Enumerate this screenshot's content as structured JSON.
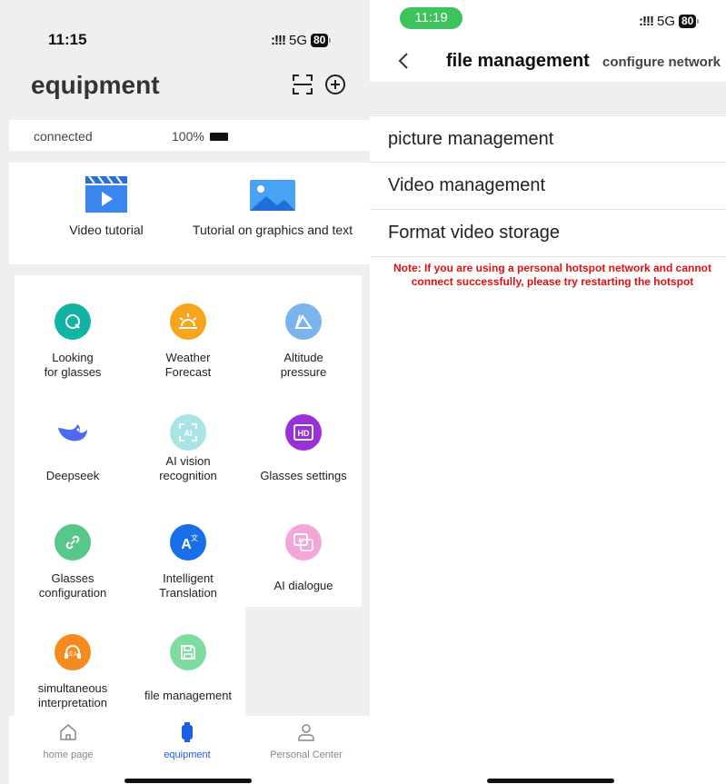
{
  "left": {
    "status": {
      "time": "11:15",
      "network": "5G",
      "battery": "80"
    },
    "header": {
      "title": "equipment"
    },
    "connection": {
      "status": "connected",
      "battery_pct": "100%"
    },
    "tutorials": [
      "Video tutorial",
      "Tutorial on graphics and text"
    ],
    "grid": [
      {
        "label": "Looking\nfor glasses",
        "icon": "search-icon",
        "color": "#12b3a4"
      },
      {
        "label": "Weather\nForecast",
        "icon": "weather-icon",
        "color": "#f7a51c"
      },
      {
        "label": "Altitude\npressure",
        "icon": "mountain-icon",
        "color": "#7bb3ee"
      },
      {
        "label": "Deepseek",
        "icon": "whale-icon",
        "color": "#4c6bf0"
      },
      {
        "label": "AI vision\nrecognition",
        "icon": "ai-scan-icon",
        "color": "#a8e4e4"
      },
      {
        "label": "Glasses settings",
        "icon": "hd-icon",
        "color": "#9b2fd8"
      },
      {
        "label": "Glasses\nconfiguration",
        "icon": "link-icon",
        "color": "#56c98a"
      },
      {
        "label": "Intelligent\nTranslation",
        "icon": "translate-icon",
        "color": "#1a6ee8"
      },
      {
        "label": "AI dialogue",
        "icon": "ai-chat-icon",
        "color": "#f3a6d8"
      },
      {
        "label": "simultaneous\ninterpretation",
        "icon": "headset-icon",
        "color": "#f58a1f"
      },
      {
        "label": "file management",
        "icon": "save-icon",
        "color": "#7fdca0"
      }
    ],
    "tabs": [
      {
        "label": "home page",
        "icon": "home-icon",
        "active": false
      },
      {
        "label": "equipment",
        "icon": "watch-icon",
        "active": true
      },
      {
        "label": "Personal Center",
        "icon": "person-icon",
        "active": false
      }
    ]
  },
  "right": {
    "status": {
      "time": "11:19",
      "network": "5G",
      "battery": "80"
    },
    "header": {
      "title": "file management",
      "action": "configure network"
    },
    "menu": [
      "picture management",
      "Video management",
      "Format video storage"
    ],
    "note": "Note: If you are using a personal hotspot network and cannot connect successfully, please try restarting the hotspot"
  }
}
